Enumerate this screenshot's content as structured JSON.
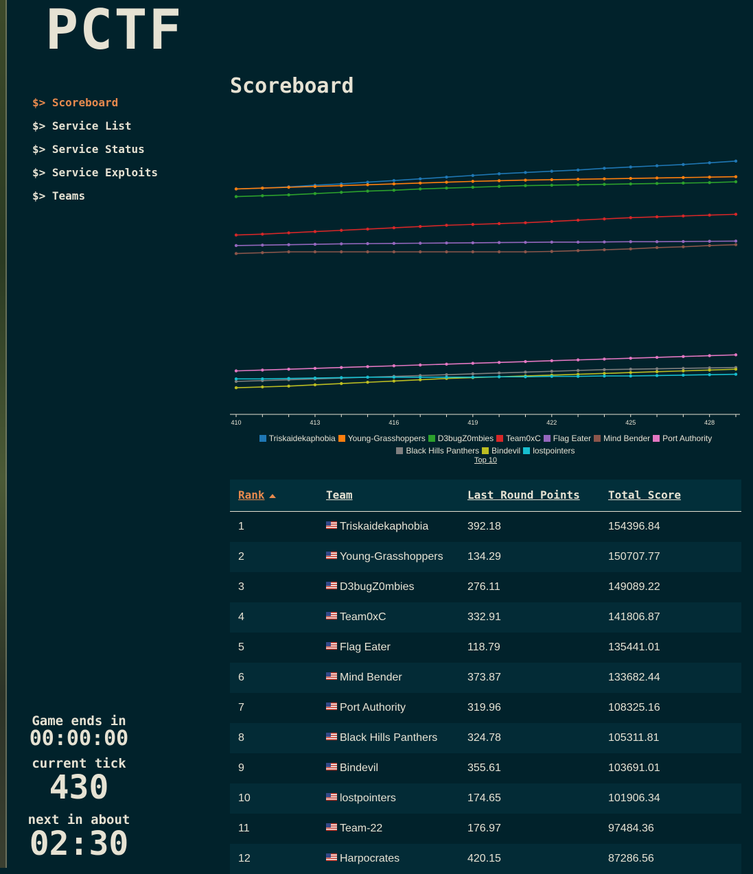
{
  "logo": "PCTF",
  "nav": [
    {
      "prompt": "$>",
      "label": "Scoreboard",
      "active": true
    },
    {
      "prompt": "$>",
      "label": "Service List",
      "active": false
    },
    {
      "prompt": "$>",
      "label": "Service Status",
      "active": false
    },
    {
      "prompt": "$>",
      "label": "Service Exploits",
      "active": false
    },
    {
      "prompt": "$>",
      "label": "Teams",
      "active": false
    }
  ],
  "status": {
    "game_ends_label": "Game ends in",
    "game_ends_value": "00:00:00",
    "tick_label": "current tick",
    "tick_value": "430",
    "next_label": "next in about",
    "next_value": "02:30"
  },
  "page_title": "Scoreboard",
  "colors": {
    "background": "#01222b",
    "text": "#e6e2d3",
    "accent": "#e88a4e",
    "row_alt": "#032b36"
  },
  "chart_data": {
    "type": "line",
    "x": [
      410,
      411,
      412,
      413,
      414,
      415,
      416,
      417,
      418,
      419,
      420,
      421,
      422,
      423,
      424,
      425,
      426,
      427,
      428,
      429
    ],
    "x_tick_labels": [
      "410",
      "413",
      "416",
      "419",
      "422",
      "425",
      "428"
    ],
    "legend_link": "Top 10",
    "series": [
      {
        "name": "Triskaidekaphobia",
        "color": "#1f77b4",
        "values": [
          147800,
          148000,
          148300,
          148700,
          149000,
          149400,
          149800,
          150200,
          150600,
          151000,
          151400,
          151700,
          152000,
          152300,
          152700,
          153000,
          153300,
          153600,
          154000,
          154400
        ]
      },
      {
        "name": "Young-Grasshoppers",
        "color": "#ff7f0e",
        "values": [
          147800,
          148000,
          148200,
          148400,
          148600,
          148800,
          149000,
          149200,
          149400,
          149600,
          149750,
          149900,
          150000,
          150100,
          150200,
          150300,
          150400,
          150500,
          150600,
          150700
        ]
      },
      {
        "name": "D3bugZ0mbies",
        "color": "#2ca02c",
        "values": [
          146000,
          146200,
          146400,
          146700,
          147000,
          147300,
          147500,
          147800,
          148000,
          148200,
          148400,
          148600,
          148700,
          148800,
          148900,
          149000,
          149100,
          149200,
          149300,
          149500
        ]
      },
      {
        "name": "Team0xC",
        "color": "#d62728",
        "values": [
          136900,
          137100,
          137400,
          137700,
          138000,
          138300,
          138600,
          138900,
          139200,
          139400,
          139600,
          139800,
          140100,
          140400,
          140700,
          141000,
          141200,
          141400,
          141600,
          141800
        ]
      },
      {
        "name": "Flag Eater",
        "color": "#9467bd",
        "values": [
          134400,
          134500,
          134600,
          134700,
          134800,
          134850,
          134900,
          134950,
          135000,
          135050,
          135100,
          135150,
          135200,
          135200,
          135250,
          135300,
          135300,
          135350,
          135400,
          135450
        ]
      },
      {
        "name": "Mind Bender",
        "color": "#8c564b",
        "values": [
          132500,
          132700,
          132900,
          132900,
          132900,
          132900,
          132900,
          132900,
          132900,
          132900,
          132900,
          132900,
          133000,
          133200,
          133400,
          133600,
          133900,
          134100,
          134400,
          134600
        ]
      },
      {
        "name": "Port Authority",
        "color": "#e377c2",
        "values": [
          104700,
          104900,
          105100,
          105300,
          105500,
          105700,
          105900,
          106100,
          106300,
          106500,
          106700,
          106900,
          107100,
          107300,
          107500,
          107700,
          107900,
          108100,
          108300,
          108500
        ]
      },
      {
        "name": "Black Hills Panthers",
        "color": "#7f7f7f",
        "values": [
          102200,
          102400,
          102600,
          102800,
          103000,
          103200,
          103400,
          103600,
          103800,
          104000,
          104200,
          104400,
          104600,
          104800,
          105000,
          105100,
          105200,
          105300,
          105400,
          105500
        ]
      },
      {
        "name": "Bindevil",
        "color": "#bcbd22",
        "values": [
          100700,
          100900,
          101100,
          101400,
          101700,
          102000,
          102300,
          102600,
          102900,
          103100,
          103300,
          103500,
          103700,
          103900,
          104100,
          104300,
          104500,
          104700,
          104900,
          105100
        ]
      },
      {
        "name": "lostpointers",
        "color": "#17becf",
        "values": [
          102800,
          102800,
          102900,
          103000,
          103100,
          103200,
          103200,
          103200,
          103200,
          103200,
          103300,
          103300,
          103400,
          103400,
          103500,
          103500,
          103600,
          103700,
          103800,
          103900
        ]
      }
    ],
    "ylim": [
      97000,
      156000
    ]
  },
  "table": {
    "headers": {
      "rank": "Rank",
      "team": "Team",
      "last": "Last Round Points",
      "total": "Total Score"
    },
    "flag_icon": "us-flag-icon",
    "rows": [
      {
        "rank": "1",
        "team": "Triskaidekaphobia",
        "last": "392.18",
        "total": "154396.84"
      },
      {
        "rank": "2",
        "team": "Young-Grasshoppers",
        "last": "134.29",
        "total": "150707.77"
      },
      {
        "rank": "3",
        "team": "D3bugZ0mbies",
        "last": "276.11",
        "total": "149089.22"
      },
      {
        "rank": "4",
        "team": "Team0xC",
        "last": "332.91",
        "total": "141806.87"
      },
      {
        "rank": "5",
        "team": "Flag Eater",
        "last": "118.79",
        "total": "135441.01"
      },
      {
        "rank": "6",
        "team": "Mind Bender",
        "last": "373.87",
        "total": "133682.44"
      },
      {
        "rank": "7",
        "team": "Port Authority",
        "last": "319.96",
        "total": "108325.16"
      },
      {
        "rank": "8",
        "team": "Black Hills Panthers",
        "last": "324.78",
        "total": "105311.81"
      },
      {
        "rank": "9",
        "team": "Bindevil",
        "last": "355.61",
        "total": "103691.01"
      },
      {
        "rank": "10",
        "team": "lostpointers",
        "last": "174.65",
        "total": "101906.34"
      },
      {
        "rank": "11",
        "team": "Team-22",
        "last": "176.97",
        "total": "97484.36"
      },
      {
        "rank": "12",
        "team": "Harpocrates",
        "last": "420.15",
        "total": "87286.56"
      }
    ]
  }
}
